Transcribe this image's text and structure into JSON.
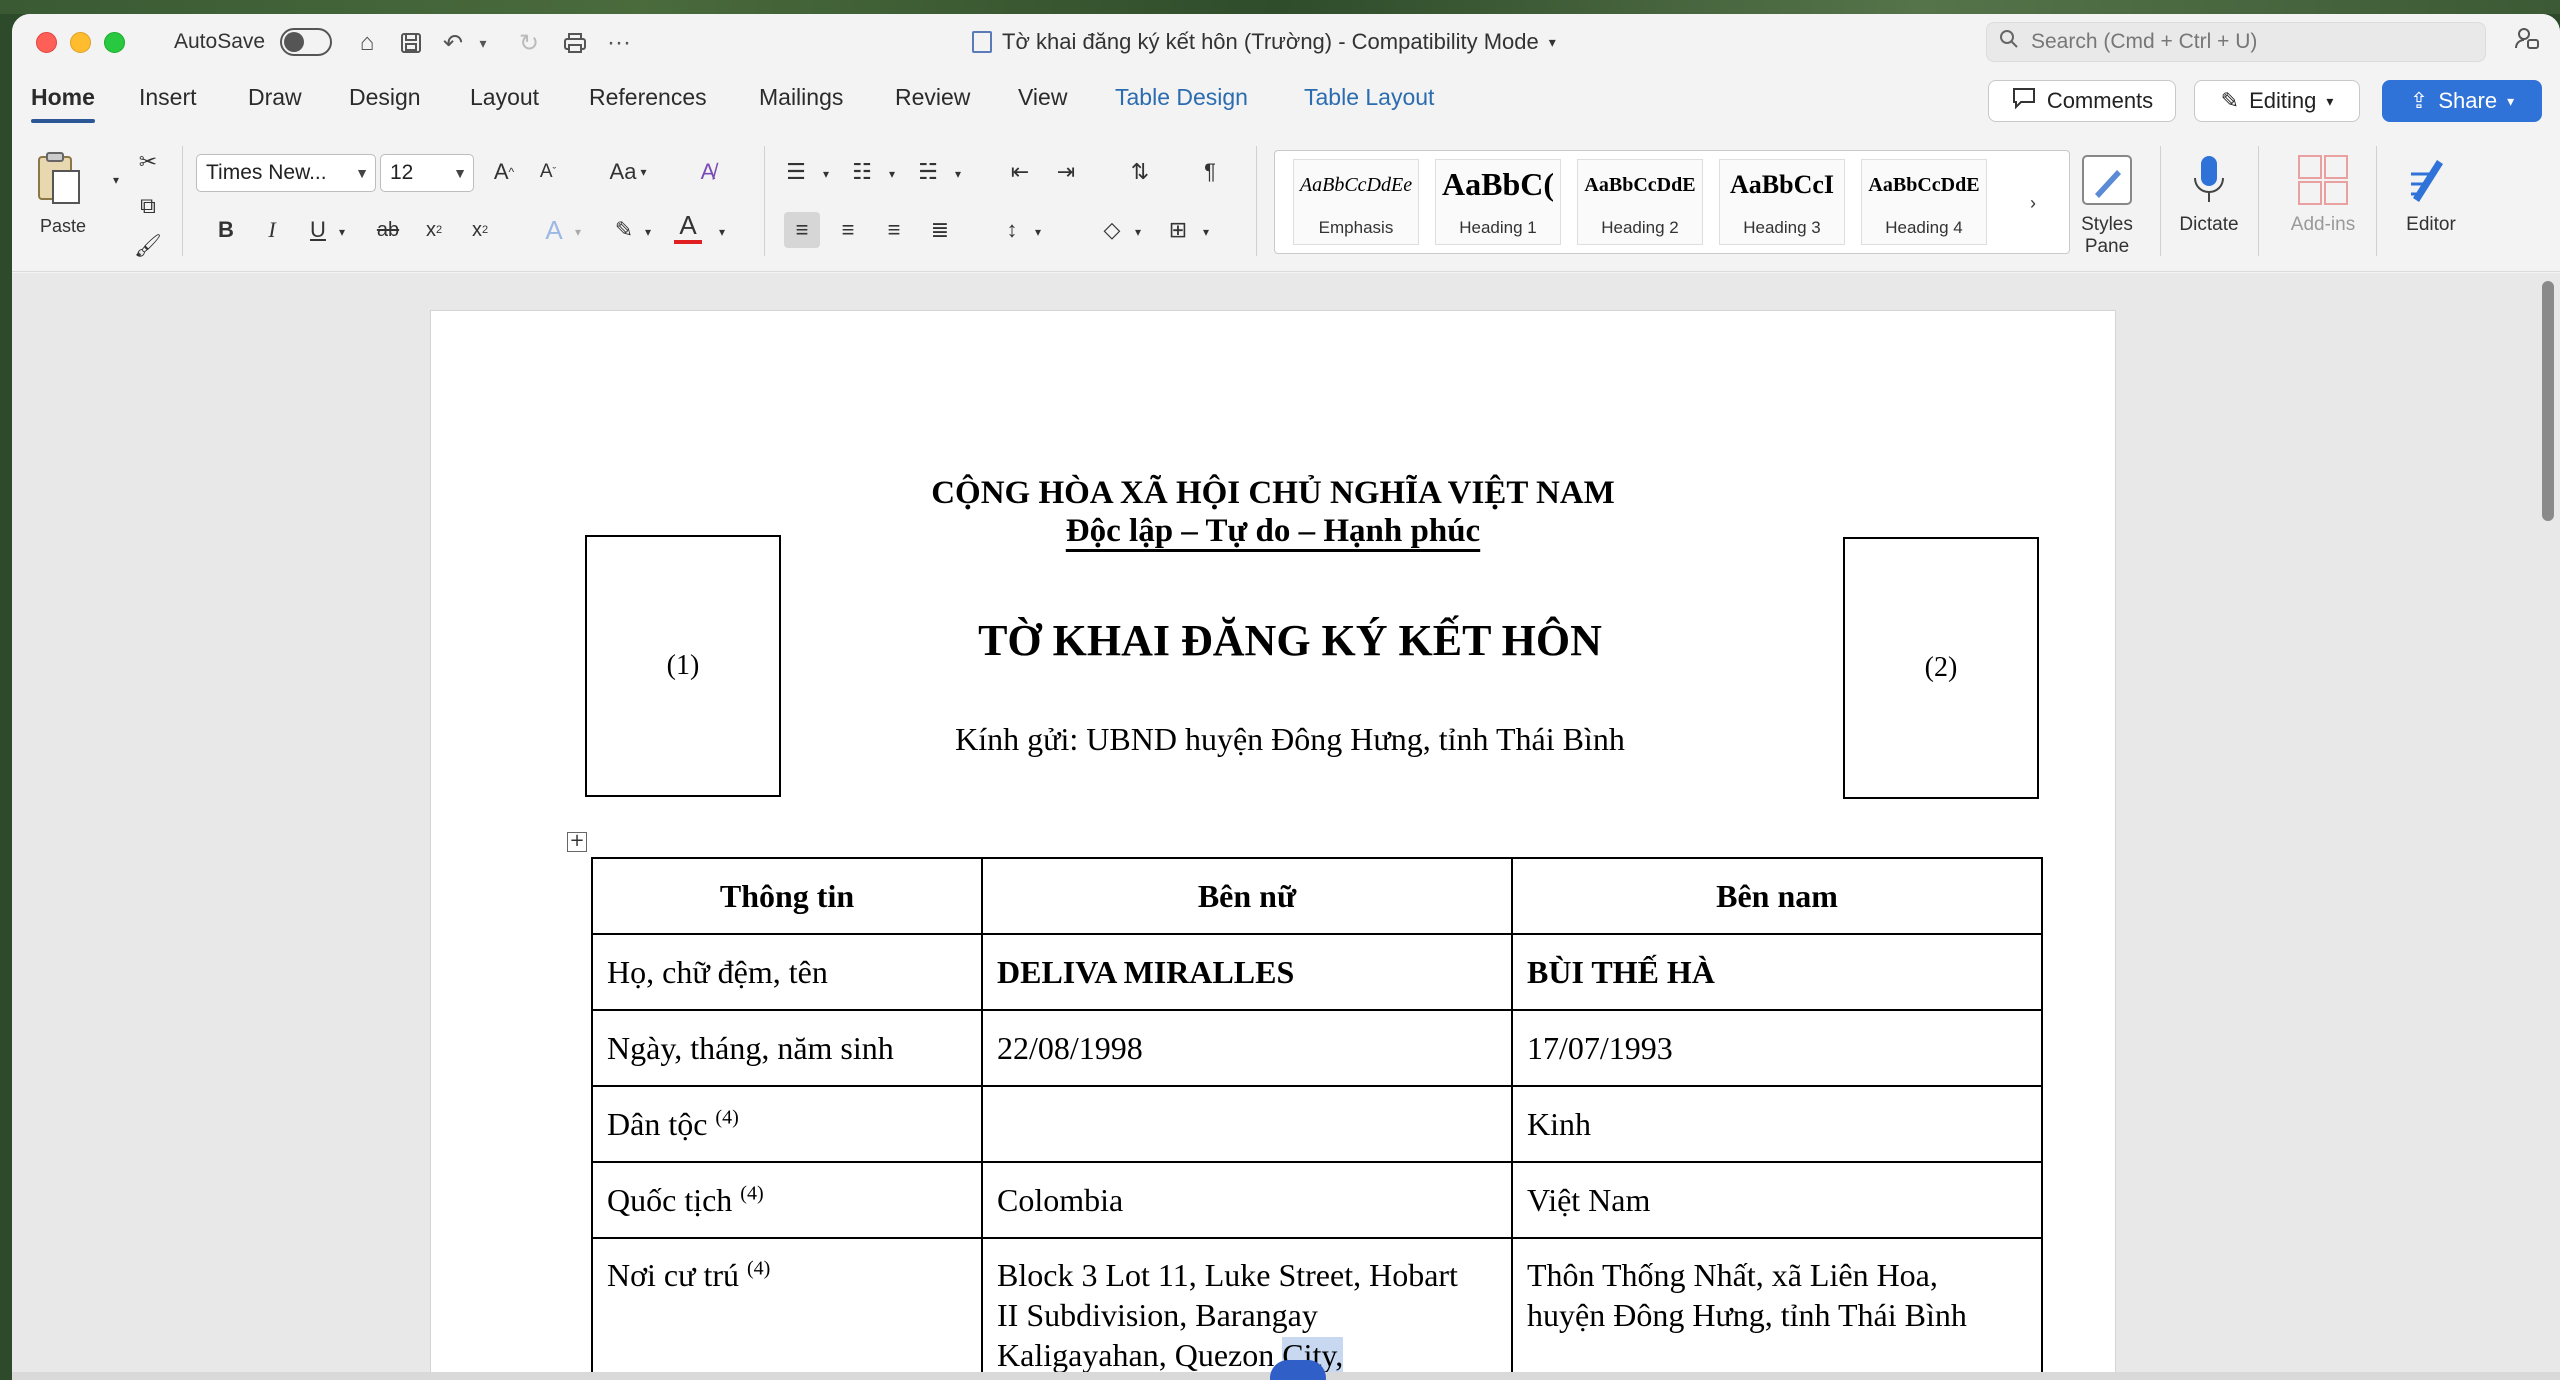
{
  "window": {
    "autosave_label": "AutoSave",
    "title": "Tờ khai đăng ký kết hôn (Trường)  -  Compatibility Mode",
    "search_placeholder": "Search (Cmd + Ctrl + U)"
  },
  "tabs": [
    "Home",
    "Insert",
    "Draw",
    "Design",
    "Layout",
    "References",
    "Mailings",
    "Review",
    "View",
    "Table Design",
    "Table Layout"
  ],
  "actions": {
    "comments": "Comments",
    "editing": "Editing",
    "share": "Share"
  },
  "ribbon": {
    "paste_label": "Paste",
    "font_name": "Times New...",
    "font_size": "12",
    "change_case": "Aa",
    "styles": [
      {
        "sample": "AaBbCcDdEe",
        "name": "Emphasis"
      },
      {
        "sample": "AaBbC(",
        "name": "Heading 1"
      },
      {
        "sample": "AaBbCcDdE",
        "name": "Heading 2"
      },
      {
        "sample": "AaBbCcI",
        "name": "Heading 3"
      },
      {
        "sample": "AaBbCcDdE",
        "name": "Heading 4"
      }
    ],
    "styles_pane_label": "Styles Pane",
    "dictate_label": "Dictate",
    "addins_label": "Add-ins",
    "editor_label": "Editor"
  },
  "document": {
    "nation": "CỘNG HÒA XÃ HỘI CHỦ NGHĨA VIỆT NAM",
    "motto": "Độc lập – Tự do – Hạnh phúc",
    "photo_left": "(1)",
    "photo_right": "(2)",
    "form_title": "TỜ KHAI ĐĂNG KÝ KẾT HÔN",
    "recipient": "Kính gửi: UBND huyện Đông Hưng, tỉnh Thái Bình",
    "table": {
      "headers": [
        "Thông tin",
        "Bên nữ",
        "Bên nam"
      ],
      "rows": [
        {
          "label": "Họ, chữ đệm, tên",
          "sup": "",
          "female": "DELIVA MIRALLES",
          "male": "BÙI THẾ HÀ"
        },
        {
          "label": "Ngày, tháng, năm sinh",
          "sup": "",
          "female": "22/08/1998",
          "male": "17/07/1993"
        },
        {
          "label": "Dân tộc",
          "sup": "(4)",
          "female": "",
          "male": "Kinh"
        },
        {
          "label": "Quốc tịch",
          "sup": "(4)",
          "female": "Colombia",
          "male": "Việt Nam"
        },
        {
          "label": "Nơi cư trú",
          "sup": "(4)",
          "female_l1": "Block 3 Lot 11, Luke Street, Hobart",
          "female_l2": "II Subdivision, Barangay",
          "female_l3a": "Kaligayahan, Quezon ",
          "female_l3b": "City,",
          "male_l1": "Thôn Thống Nhất, xã Liên Hoa,",
          "male_l2": "huyện Đông Hưng, tỉnh Thái Bình"
        }
      ]
    }
  },
  "colors": {
    "accent": "#2b5797",
    "share": "#2f72d8",
    "table_tab": "#2b6cb0"
  }
}
